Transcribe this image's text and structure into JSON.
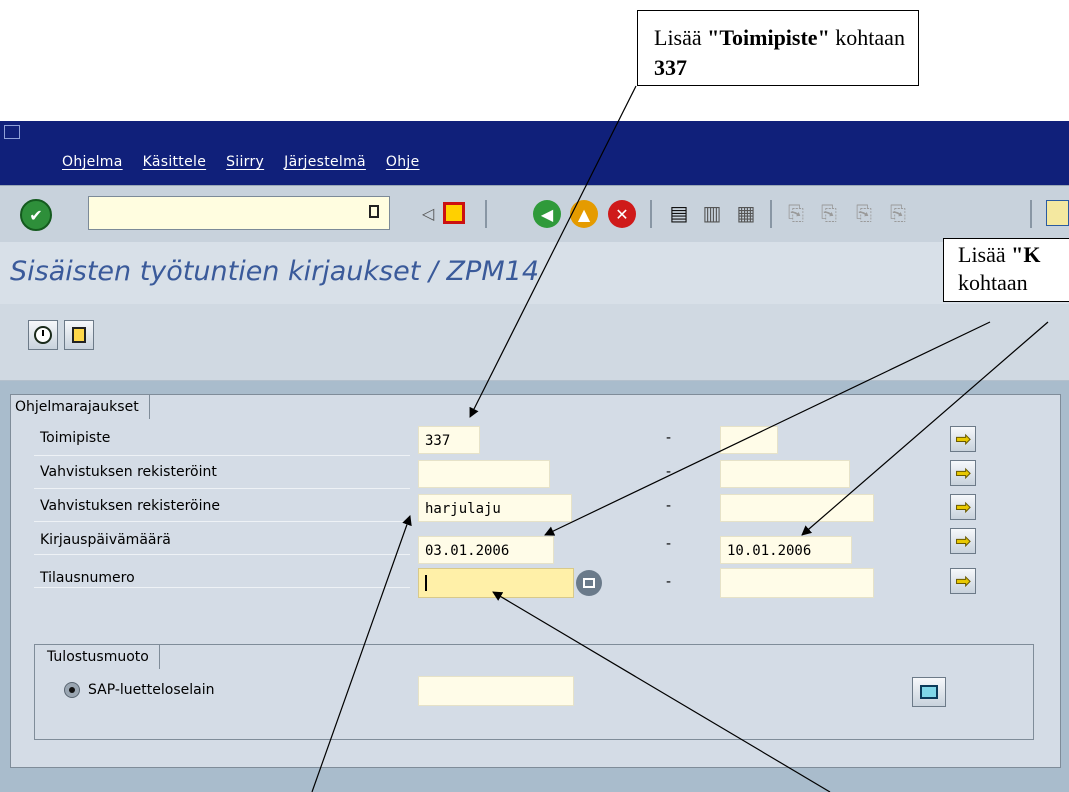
{
  "callouts": {
    "top": {
      "prefix": "Lisää ",
      "field": "\"Toimipiste\"",
      "middle": " kohtaan ",
      "value": "337"
    },
    "right": {
      "line1_prefix": "Lisää ",
      "line1_field": "\"K",
      "line2": "kohtaan"
    }
  },
  "menu": [
    "Ohjelma",
    "Käsittele",
    "Siirry",
    "Järjestelmä",
    "Ohje"
  ],
  "page_title": "Sisäisten työtuntien kirjaukset / ZPM14",
  "group1": {
    "tab": "Ohjelmarajaukset",
    "rows": [
      {
        "label": "Toimipiste",
        "from": "337",
        "to": ""
      },
      {
        "label": "Vahvistuksen rekisteröint",
        "from": "",
        "to": ""
      },
      {
        "label": "Vahvistuksen rekisteröine",
        "from": "harjulaju",
        "to": ""
      },
      {
        "label": "Kirjauspäivämäärä",
        "from": "03.01.2006",
        "to": "10.01.2006"
      },
      {
        "label": "Tilausnumero",
        "from": "",
        "to": ""
      }
    ],
    "dash": "-"
  },
  "group2": {
    "tab": "Tulostusmuoto",
    "radio_label": "SAP-luetteloselain"
  },
  "colors": {
    "titlebar": "#10207a",
    "title_text": "#3a5a9a",
    "work_bg": "#a9bccc"
  }
}
